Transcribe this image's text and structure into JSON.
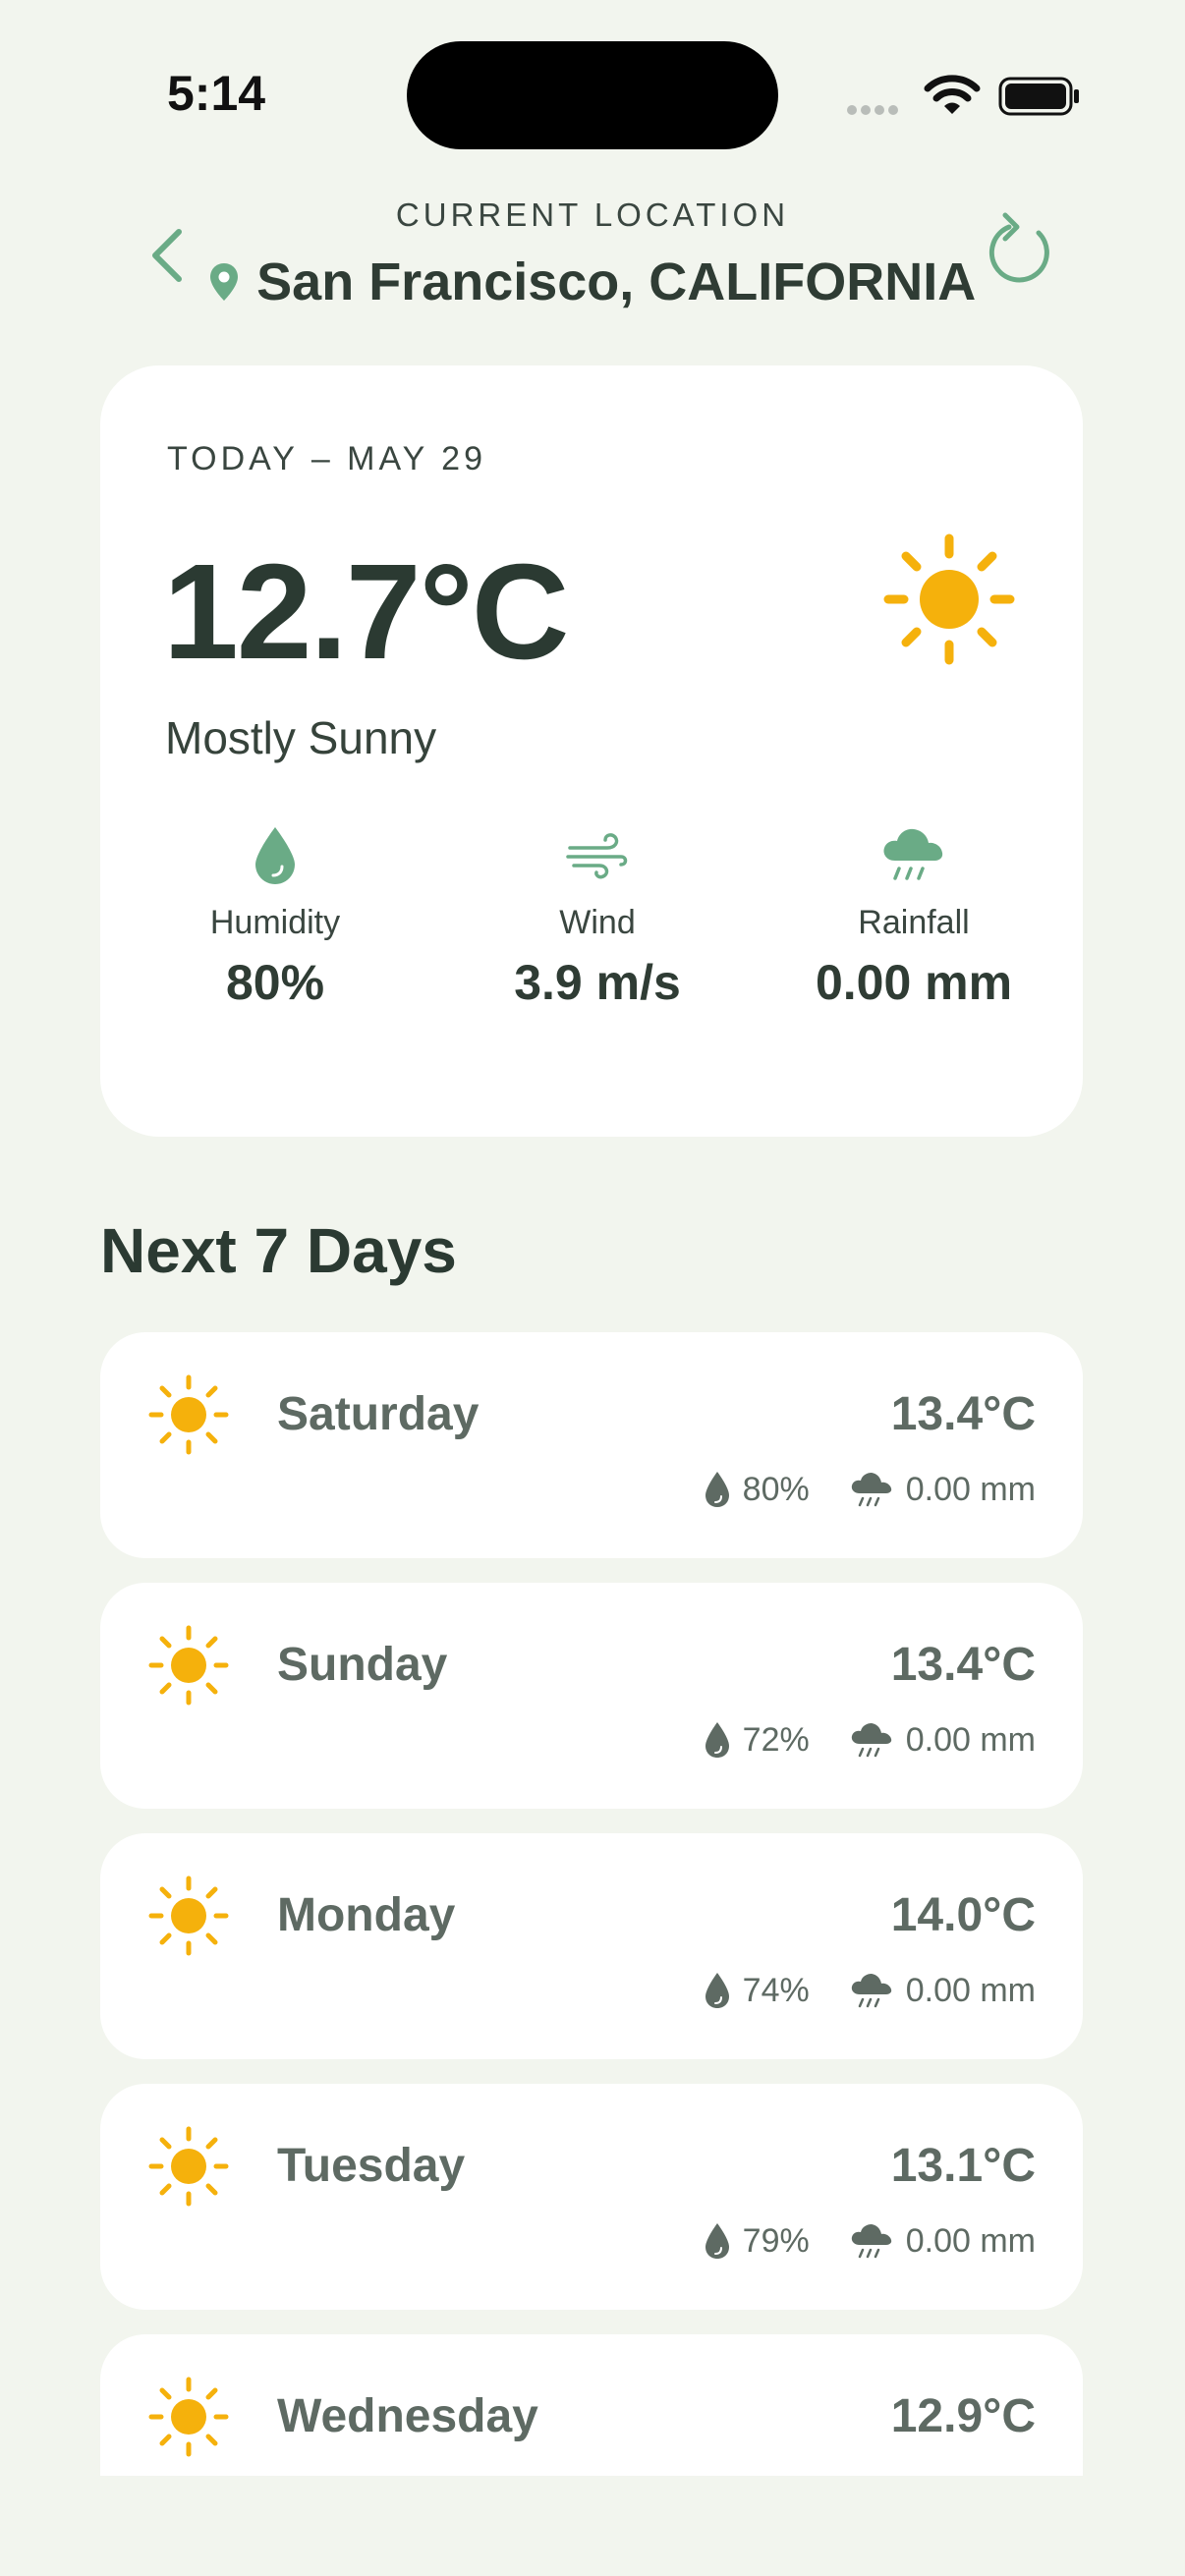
{
  "status_bar": {
    "time": "5:14"
  },
  "header": {
    "caption": "CURRENT LOCATION",
    "location": "San Francisco, CALIFORNIA"
  },
  "today": {
    "date_label": "TODAY – MAY 29",
    "temperature": "12.7°C",
    "condition": "Mostly Sunny",
    "condition_icon": "sun-icon",
    "stats": [
      {
        "icon": "droplet-icon",
        "label": "Humidity",
        "value": "80%"
      },
      {
        "icon": "wind-icon",
        "label": "Wind",
        "value": "3.9 m/s"
      },
      {
        "icon": "rain-cloud-icon",
        "label": "Rainfall",
        "value": "0.00 mm"
      }
    ]
  },
  "forecast": {
    "title": "Next 7 Days",
    "days": [
      {
        "name": "Saturday",
        "temp": "13.4°C",
        "humidity": "80%",
        "rain": "0.00 mm"
      },
      {
        "name": "Sunday",
        "temp": "13.4°C",
        "humidity": "72%",
        "rain": "0.00 mm"
      },
      {
        "name": "Monday",
        "temp": "14.0°C",
        "humidity": "74%",
        "rain": "0.00 mm"
      },
      {
        "name": "Tuesday",
        "temp": "13.1°C",
        "humidity": "79%",
        "rain": "0.00 mm"
      },
      {
        "name": "Wednesday",
        "temp": "12.9°C",
        "humidity": "",
        "rain": ""
      }
    ]
  },
  "colors": {
    "background": "#f2f5ee",
    "card": "#ffffff",
    "accent_green": "#6aab86",
    "sun": "#f5b10c",
    "text_dark": "#2b3a32",
    "text_muted": "#5e6a63"
  }
}
